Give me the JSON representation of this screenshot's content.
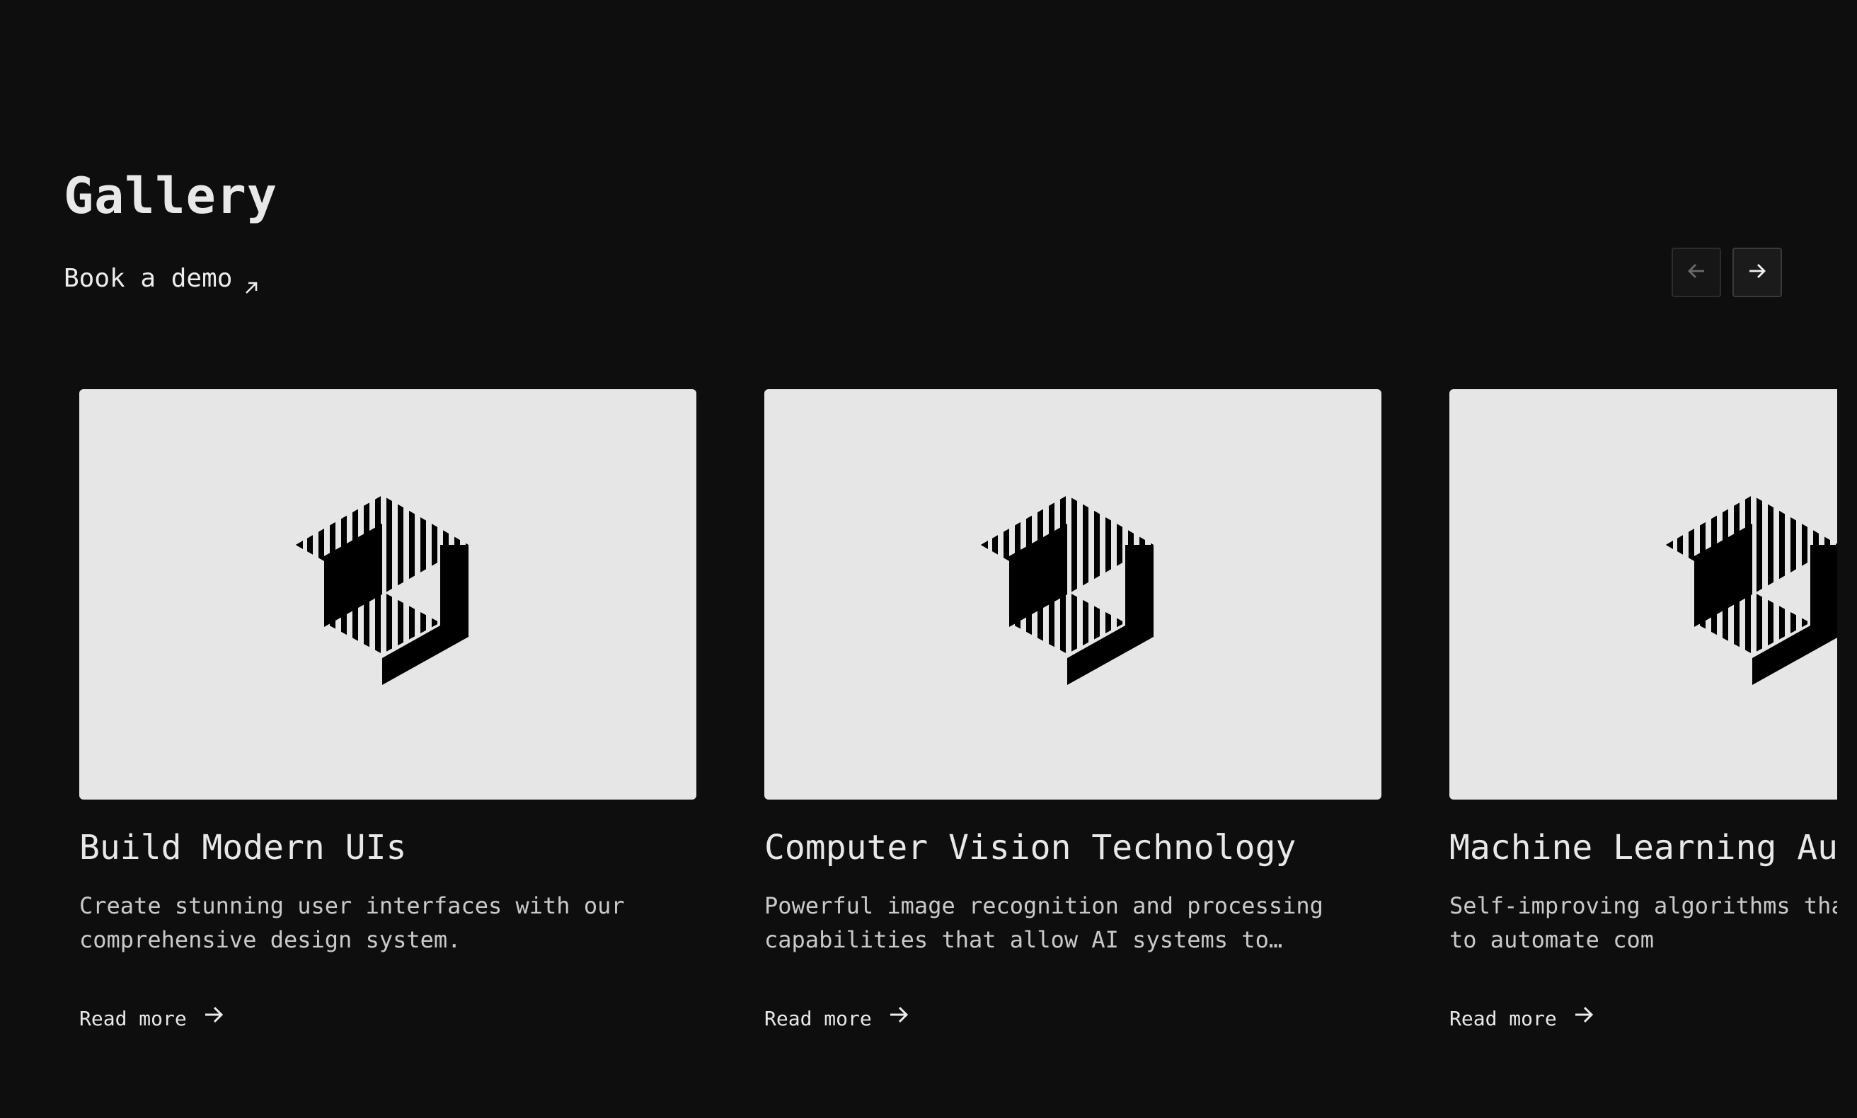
{
  "header": {
    "title": "Gallery",
    "demo_label": "Book a demo"
  },
  "nav": {
    "prev_icon": "arrow-left-icon",
    "next_icon": "arrow-right-icon"
  },
  "cards": [
    {
      "title": "Build Modern UIs",
      "description": "Create stunning user interfaces with our comprehensive design system.",
      "link": "Read more"
    },
    {
      "title": "Computer Vision Technology",
      "description": "Powerful image recognition and processing capabilities that allow AI systems to…",
      "link": "Read more"
    },
    {
      "title": "Machine Learning Au",
      "description": "Self-improving algorithms tha data patterns to automate com",
      "link": "Read more"
    }
  ],
  "colors": {
    "background": "#0e0e0e",
    "card_image": "#e6e6e6",
    "text": "#e8e8e8"
  }
}
